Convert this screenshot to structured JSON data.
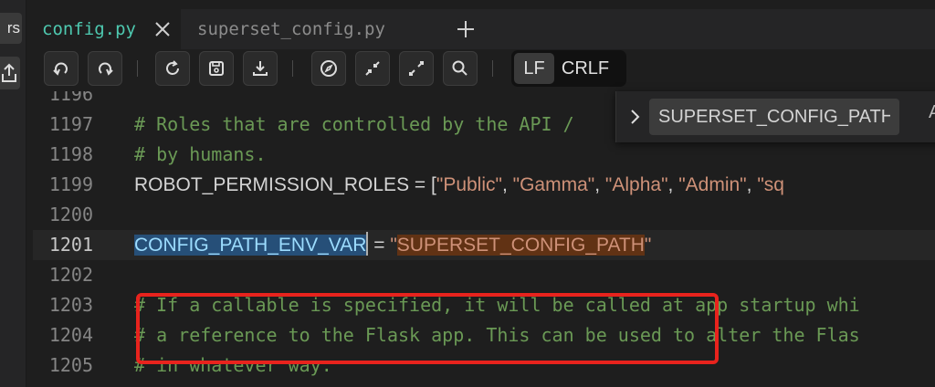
{
  "rail": {
    "label": "rs"
  },
  "tabs": [
    {
      "label": "config.py",
      "active": true
    },
    {
      "label": "superset_config.py",
      "active": false
    }
  ],
  "toolbar": {
    "buttons": [
      "undo-icon",
      "redo-icon",
      "refresh-icon",
      "save-icon",
      "download-icon",
      "compass-icon",
      "collapse-icon",
      "expand-icon",
      "search-icon"
    ],
    "eol": {
      "options": [
        "LF",
        "CRLF"
      ],
      "selected": "LF"
    }
  },
  "find": {
    "value": "SUPERSET_CONFIG_PATH",
    "extra": "A"
  },
  "editor": {
    "current_line": "1201",
    "lines": [
      {
        "num": "1196",
        "text": ""
      },
      {
        "num": "1197",
        "text": "# Roles that are controlled by the API / "
      },
      {
        "num": "1198",
        "text": "# by humans."
      },
      {
        "num": "1199",
        "ident": "ROBOT_PERMISSION_ROLES",
        "op": " = [",
        "items": [
          "\"Public\"",
          ", ",
          "\"Gamma\"",
          ", ",
          "\"Alpha\"",
          ", ",
          "\"Admin\"",
          ", ",
          "\"sq"
        ]
      },
      {
        "num": "1200",
        "text": ""
      },
      {
        "num": "1201",
        "ident": "CONFIG_PATH_ENV_VAR",
        "op": " = ",
        "q1": "\"",
        "str": "SUPERSET_CONFIG_PATH",
        "q2": "\""
      },
      {
        "num": "1202",
        "text": ""
      },
      {
        "num": "1203",
        "text": "# If a callable is specified, it will be called at app startup whi"
      },
      {
        "num": "1204",
        "text": "# a reference to the Flask app. This can be used to alter the Flas"
      },
      {
        "num": "1205",
        "text": "# in whatever way."
      }
    ]
  },
  "colors": {
    "comment": "#6a9955",
    "string": "#ce9178",
    "selection": "#264f78",
    "find_match": "#613214",
    "annotation": "#e8231d"
  }
}
